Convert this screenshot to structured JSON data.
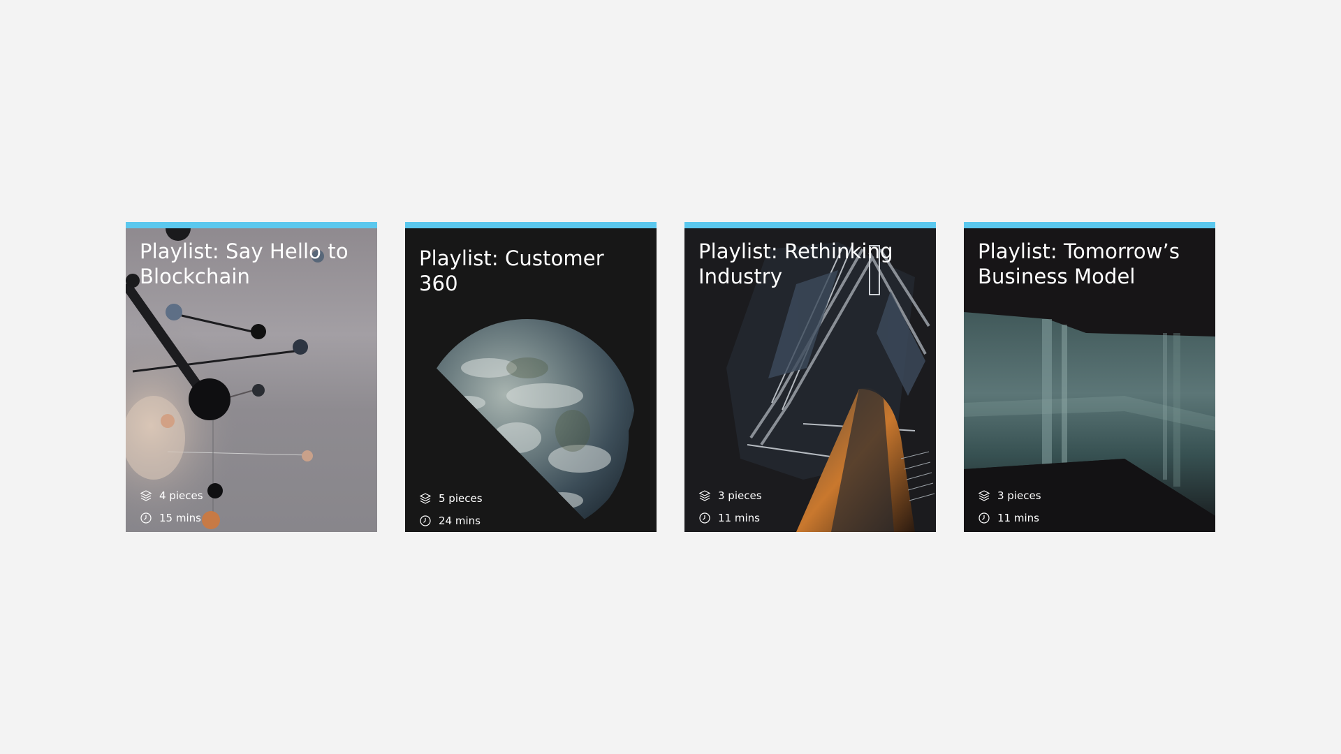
{
  "colors": {
    "page_background": "#f3f3f3",
    "accent": "#5bc8ee",
    "card_dark": "#171717"
  },
  "cards": [
    {
      "title": "Playlist: Say Hello to Blockchain",
      "pieces": "4 pieces",
      "duration": "15 mins",
      "image": "molecule-mobile"
    },
    {
      "title": "Playlist: Customer 360",
      "pieces": "5 pieces",
      "duration": "24 mins",
      "image": "earth-from-space"
    },
    {
      "title": "Playlist: Rethinking Industry",
      "pieces": "3 pieces",
      "duration": "11 mins",
      "image": "industrial-structure"
    },
    {
      "title": "Playlist: Tomorrow’s Business Model",
      "pieces": "3 pieces",
      "duration": "11 mins",
      "image": "glass-corridor"
    }
  ],
  "icons": {
    "pieces": "layers-icon",
    "duration": "clock-icon"
  }
}
